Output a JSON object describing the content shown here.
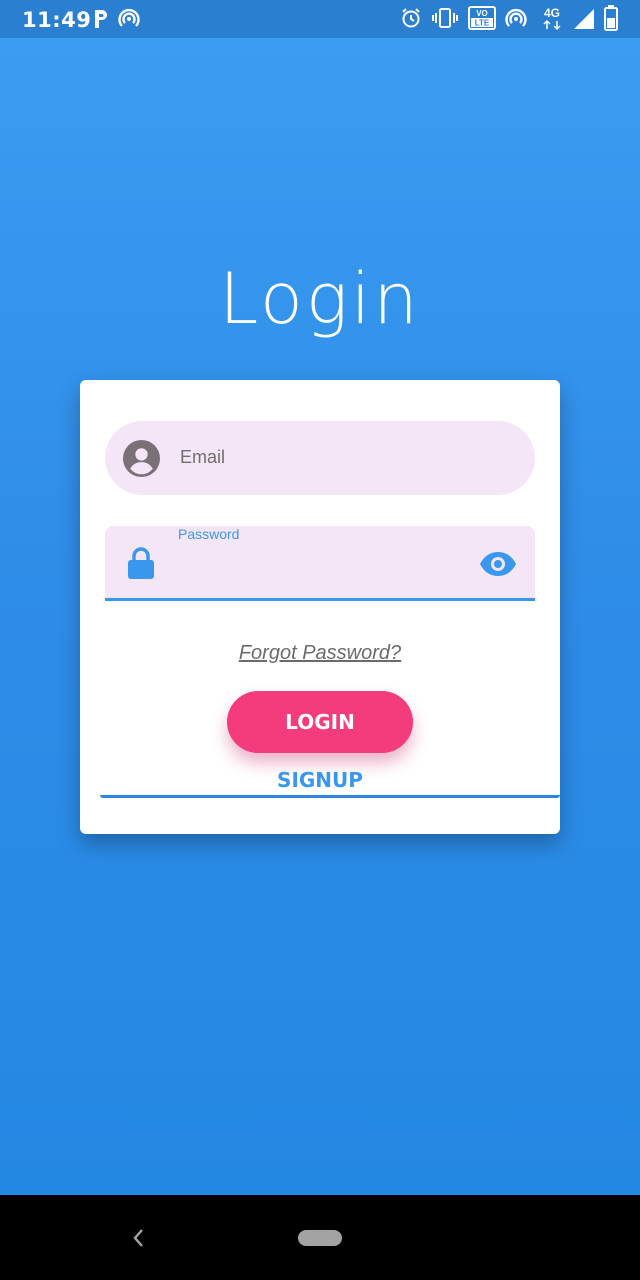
{
  "status_bar": {
    "time": "11:49",
    "icons_left": [
      "parking-icon",
      "hotspot-icon"
    ],
    "icons_right": [
      "alarm-icon",
      "vibrate-icon",
      "volte-icon",
      "hotspot-icon",
      "network-4g-icon",
      "signal-icon",
      "battery-icon"
    ],
    "volte_text": "VO LTE",
    "network_text": "4G"
  },
  "login": {
    "title": "Login",
    "email_placeholder": "Email",
    "password_label": "Password",
    "forgot_label": "Forgot Password?",
    "login_button": "LOGIN",
    "signup_button": "SIGNUP"
  },
  "colors": {
    "background": "#2f8de8",
    "field_fill": "#f4e6f6",
    "accent_blue": "#3a97ee",
    "login_button": "#f43b7b"
  },
  "nav_bar": {
    "icons": [
      "back-icon",
      "home-pill-icon"
    ]
  }
}
